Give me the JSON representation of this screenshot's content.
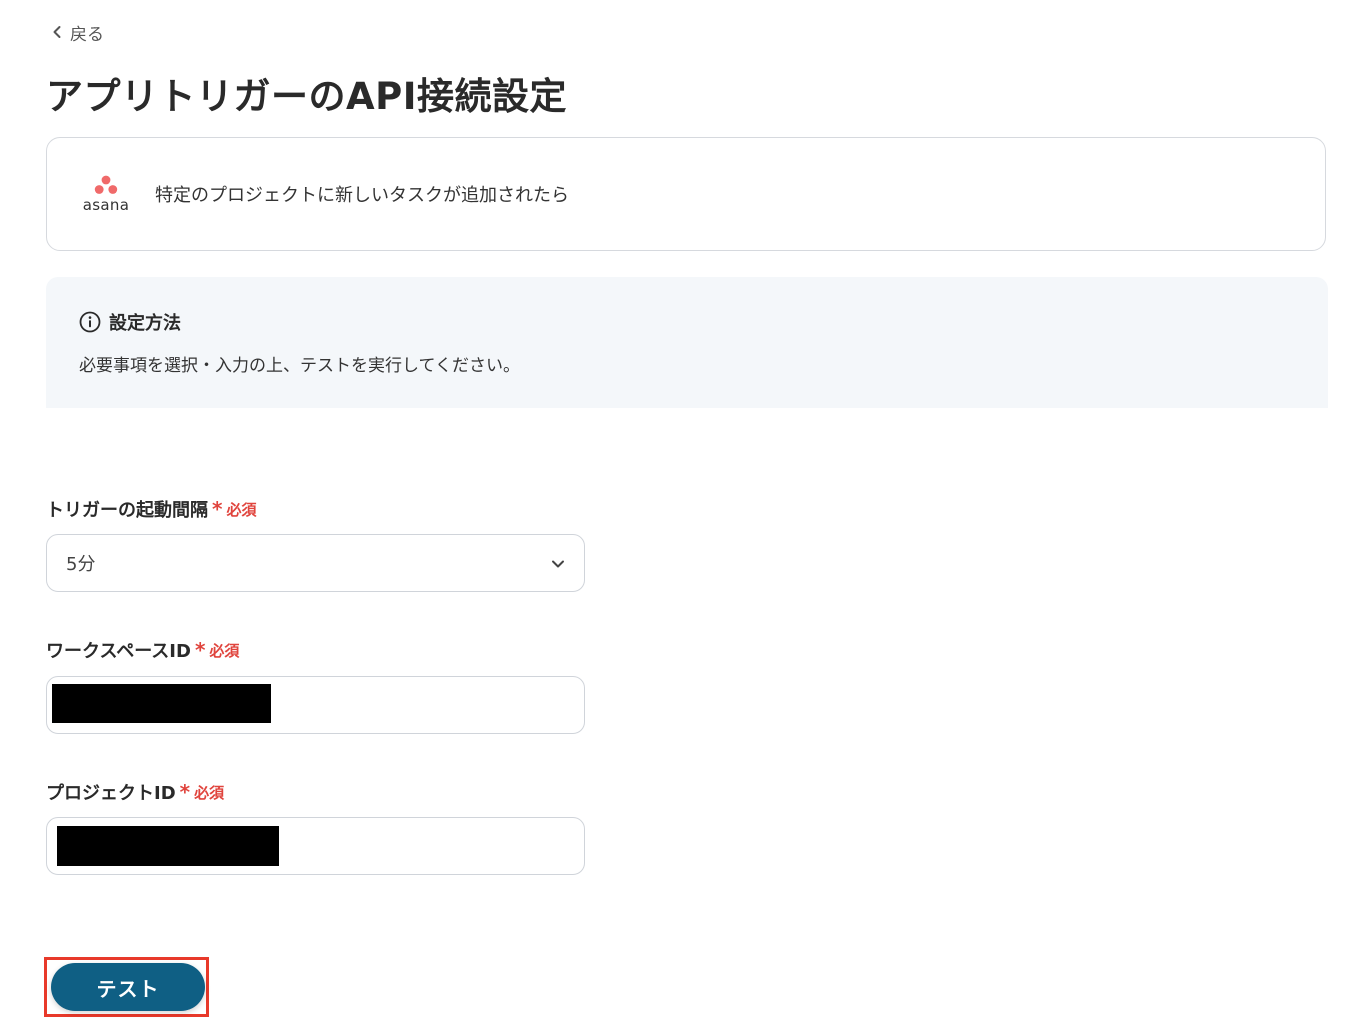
{
  "back": {
    "label": "戻る"
  },
  "page": {
    "title": "アプリトリガーのAPI接続設定"
  },
  "app_card": {
    "app_name": "asana",
    "trigger_name": "特定のプロジェクトに新しいタスクが追加されたら",
    "logo_color": "#f06a6a"
  },
  "info": {
    "heading": "設定方法",
    "description": "必要事項を選択・入力の上、テストを実行してください。"
  },
  "fields": {
    "interval": {
      "label": "トリガーの起動間隔",
      "required": "必須",
      "value": "5分"
    },
    "workspace_id": {
      "label": "ワークスペースID",
      "required": "必須"
    },
    "project_id": {
      "label": "プロジェクトID",
      "required": "必須"
    }
  },
  "actions": {
    "test_label": "テスト"
  },
  "colors": {
    "primary": "#0f5f84",
    "required": "#e0443d",
    "highlight": "#e8392a"
  }
}
